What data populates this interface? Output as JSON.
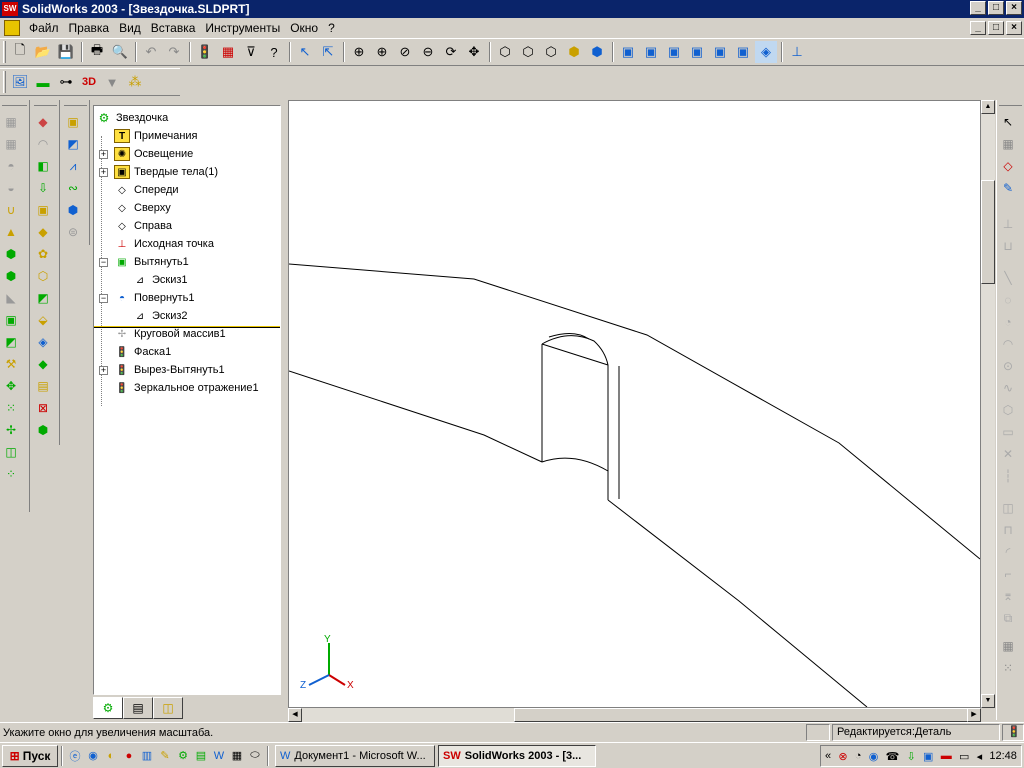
{
  "window": {
    "title": "SolidWorks 2003 - [Звездочка.SLDPRT]",
    "app_icon_text": "SW",
    "min": "_",
    "max": "□",
    "close": "×"
  },
  "menu": {
    "items": [
      "Файл",
      "Правка",
      "Вид",
      "Вставка",
      "Инструменты",
      "Окно",
      "?"
    ]
  },
  "tree": {
    "root": "Звездочка",
    "items": [
      {
        "label": "Примечания"
      },
      {
        "label": "Освещение"
      },
      {
        "label": "Твердые тела(1)"
      },
      {
        "label": "Спереди"
      },
      {
        "label": "Сверху"
      },
      {
        "label": "Справа"
      },
      {
        "label": "Исходная точка"
      },
      {
        "label": "Вытянуть1"
      },
      {
        "label": "Эскиз1"
      },
      {
        "label": "Повернуть1"
      },
      {
        "label": "Эскиз2"
      },
      {
        "label": "Круговой массив1"
      },
      {
        "label": "Фаска1"
      },
      {
        "label": "Вырез-Вытянуть1"
      },
      {
        "label": "Зеркальное отражение1"
      }
    ]
  },
  "axes": {
    "x": "X",
    "y": "Y",
    "z": "Z"
  },
  "status": {
    "message": "Укажите окно для увеличения масштаба.",
    "mode": "Редактируется:Деталь"
  },
  "taskbar": {
    "start": "Пуск",
    "tasks": [
      "Документ1 - Microsoft W...",
      "SolidWorks 2003 - [3..."
    ],
    "tray_chevron": "«",
    "clock": "12:48"
  },
  "colors": {
    "titlebar": "#0a246a",
    "rollback": "#e8c400",
    "accent_blue": "#1060d0"
  }
}
